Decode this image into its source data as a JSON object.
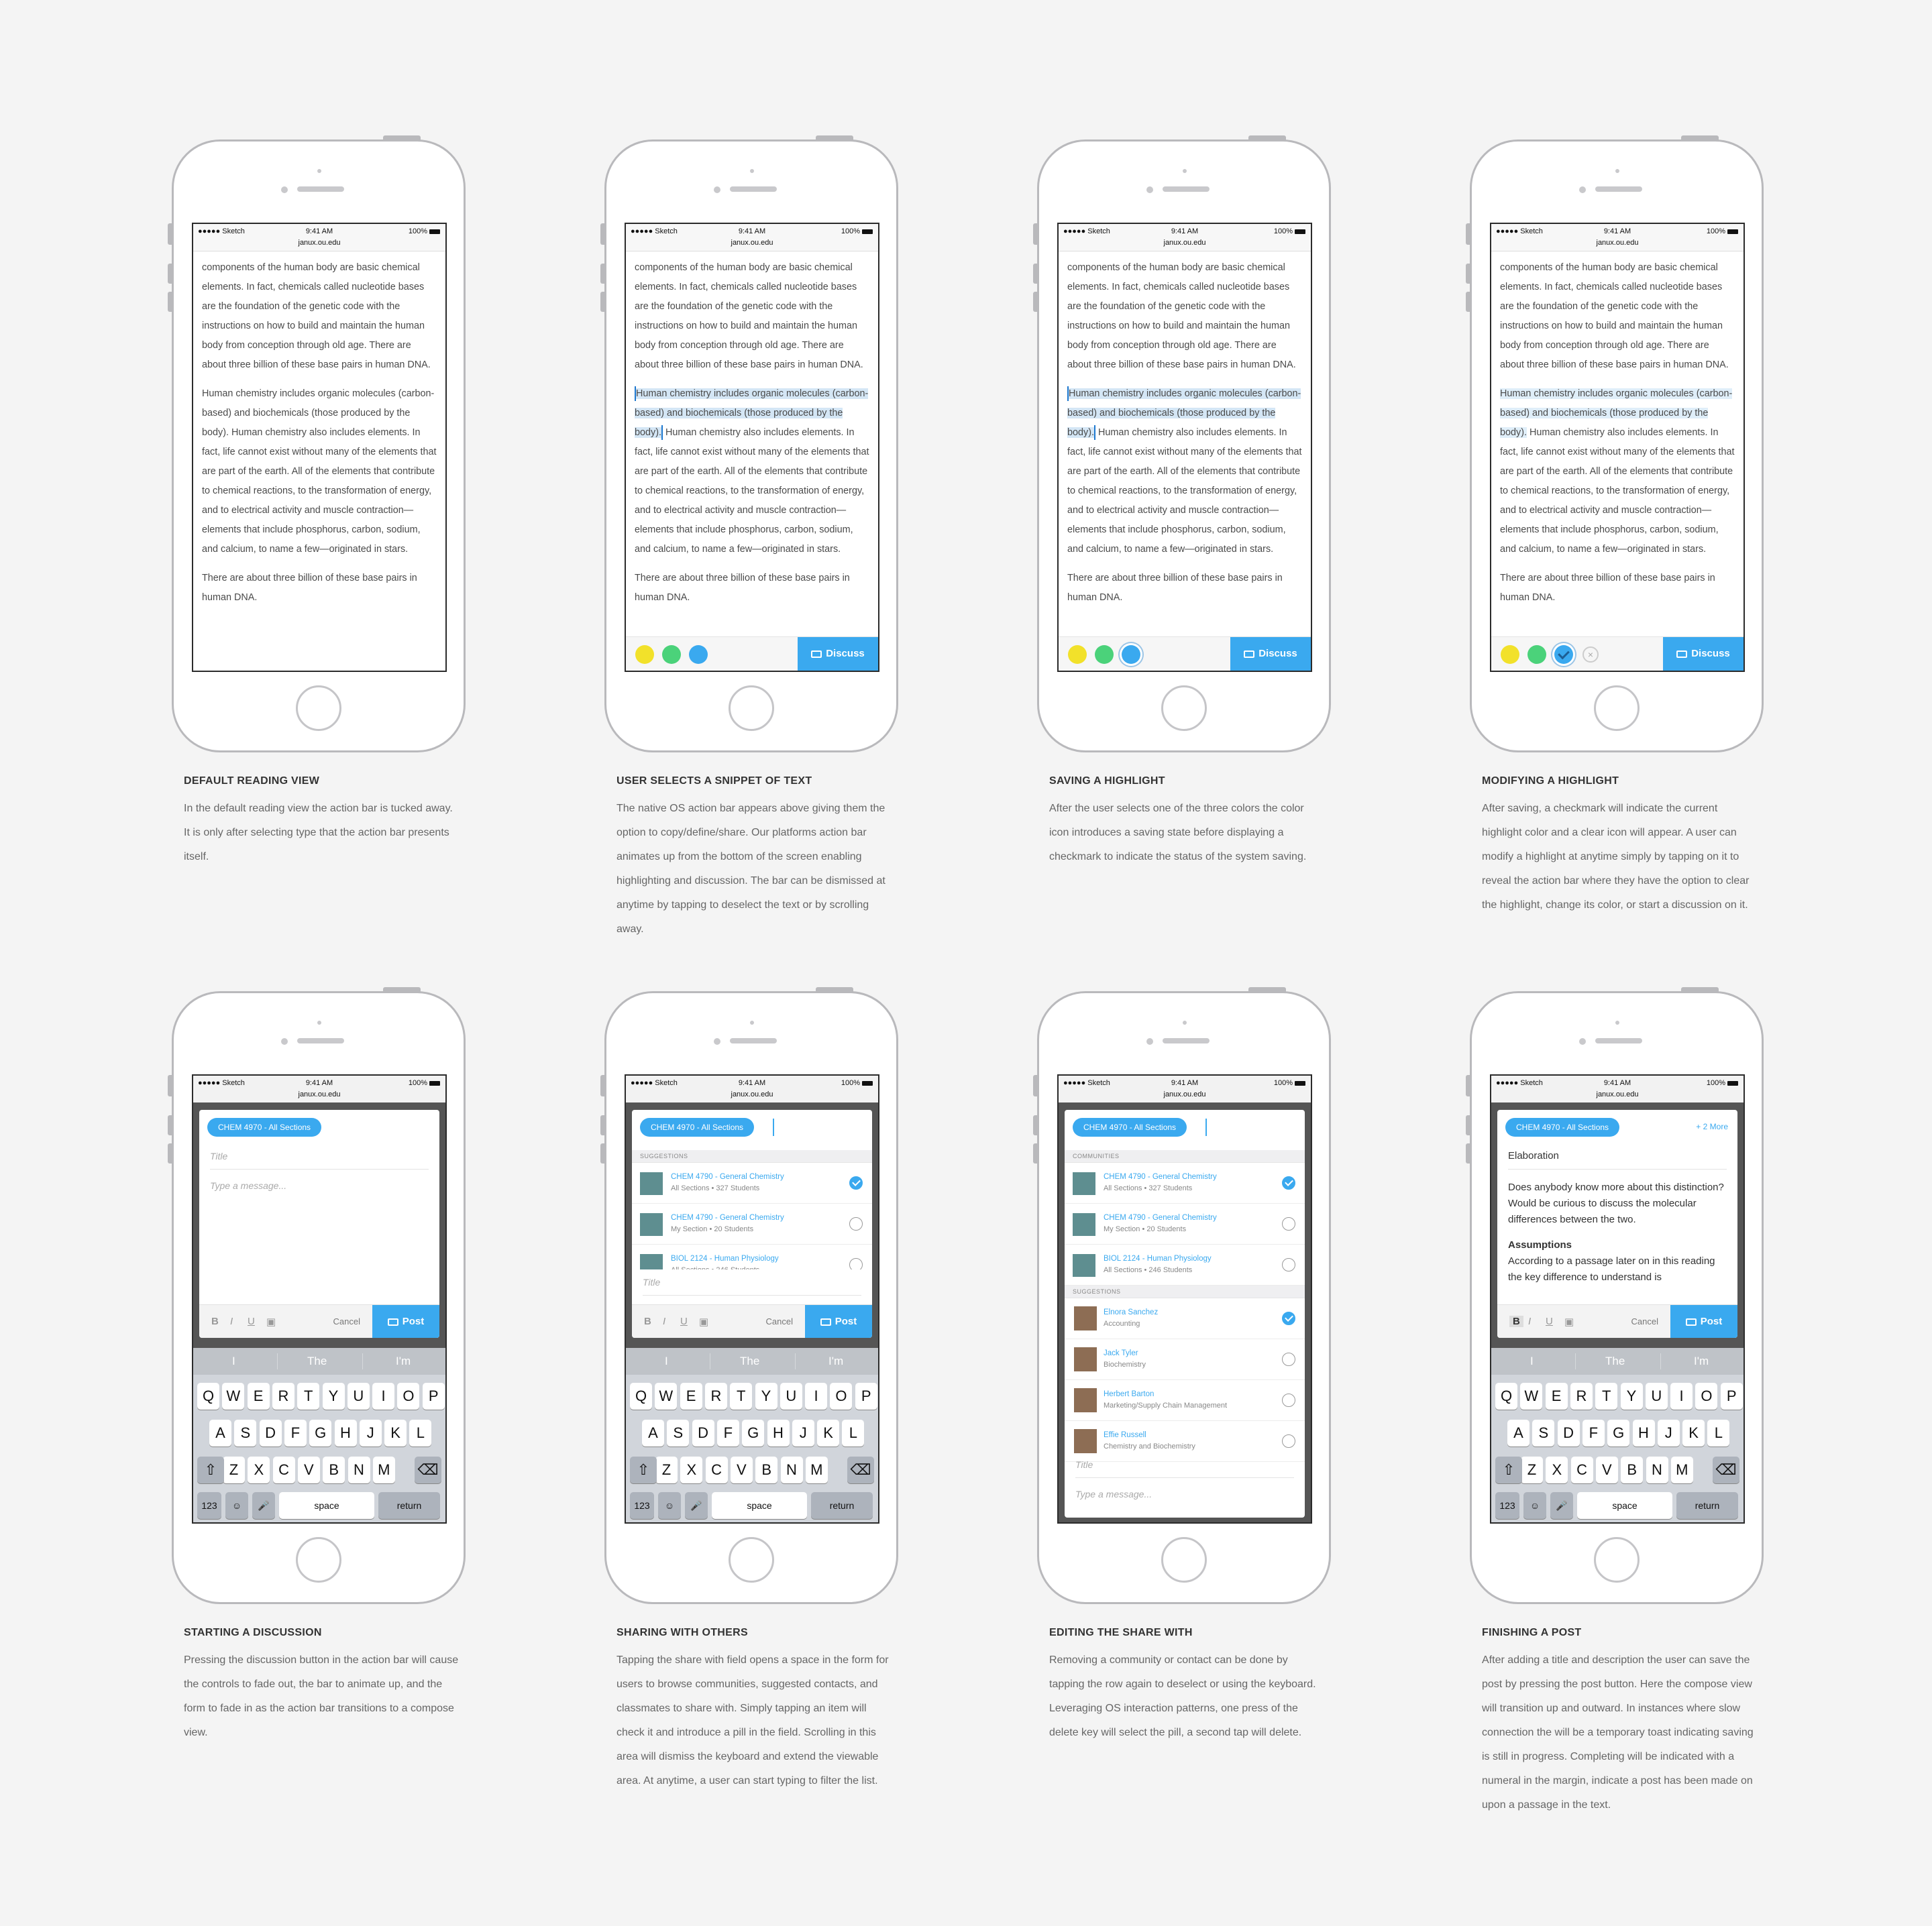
{
  "status": {
    "carrier": "●●●●● Sketch",
    "time": "9:41 AM",
    "battery": "100%",
    "url": "janux.ou.edu"
  },
  "article": {
    "p1": "components of the human body are basic chemical elements. In fact, chemicals called nucleotide bases are the foundation of the genetic code with the instructions on how to build and maintain the human body from conception through old age. There are about three billion of these base pairs in human DNA.",
    "p2_sel": "Human chemistry includes organic molecules (carbon-based) and biochemicals (those produced by the body).",
    "p2_rest": " Human chemistry also includes elements. In fact, life cannot exist without many of the elements that are part of the earth. All of the elements that contribute to chemical reactions, to the transformation of energy, and to electrical activity and muscle contraction—elements that include phosphorus, carbon, sodium, and calcium, to name a few—originated in stars.",
    "p3": "There are about three billion of these base pairs in human DNA."
  },
  "action_bar": {
    "discuss": "Discuss",
    "clear": "×"
  },
  "compose": {
    "pill": "CHEM 4970 - All Sections",
    "more": "+ 2 More",
    "title_ph": "Title",
    "message_ph": "Type a message...",
    "cancel": "Cancel",
    "post": "Post",
    "bold": "B",
    "italic": "I",
    "underline": "U",
    "title_value": "Elaboration",
    "body_value": "Does anybody know more about this distinction? Would be curious to discuss the molecular differences between the two.",
    "assumptions": "Assumptions",
    "assumptions_body": "According to a passage later on in this reading the key difference to understand is"
  },
  "lists": {
    "suggestions": "SUGGESTIONS",
    "communities": "COMMUNITIES",
    "c1": {
      "name": "CHEM 4790 - General Chemistry",
      "sub": "All Sections • 327 Students"
    },
    "c2": {
      "name": "CHEM 4790 - General Chemistry",
      "sub": "My Section • 20 Students"
    },
    "c3": {
      "name": "BIOL 2124 - Human Physiology",
      "sub": "All Sections • 246 Students"
    },
    "people": [
      {
        "name": "Elnora Sanchez",
        "sub": "Accounting"
      },
      {
        "name": "Jack Tyler",
        "sub": "Biochemistry"
      },
      {
        "name": "Herbert Barton",
        "sub": "Marketing/Supply Chain Management"
      },
      {
        "name": "Effie Russell",
        "sub": "Chemistry and Biochemistry"
      }
    ]
  },
  "keyboard": {
    "suggest": [
      "I",
      "The",
      "I'm"
    ],
    "row1": [
      "Q",
      "W",
      "E",
      "R",
      "T",
      "Y",
      "U",
      "I",
      "O",
      "P"
    ],
    "row2": [
      "A",
      "S",
      "D",
      "F",
      "G",
      "H",
      "J",
      "K",
      "L"
    ],
    "row3": [
      "Z",
      "X",
      "C",
      "V",
      "B",
      "N",
      "M"
    ],
    "num": "123",
    "space": "space",
    "return": "return"
  },
  "captions": [
    {
      "title": "DEFAULT READING VIEW",
      "body": "In the default reading view the action bar is tucked away. It is only after selecting type that the action bar presents itself."
    },
    {
      "title": "USER SELECTS A SNIPPET OF TEXT",
      "body": "The native OS action bar appears above giving them the option to copy/define/share. Our platforms action bar animates up from the bottom of the screen enabling highlighting and discussion. The bar can be dismissed at anytime by tapping to deselect the text or by scrolling away."
    },
    {
      "title": "SAVING A HIGHLIGHT",
      "body": "After the user selects one of the three colors the color icon introduces a saving state before displaying a checkmark to indicate the status of the system saving."
    },
    {
      "title": "MODIFYING A HIGHLIGHT",
      "body": "After saving, a checkmark will indicate the current highlight color and a clear icon will appear. A user can modify a highlight at anytime simply by tapping on it to reveal the action bar where they have the option to clear the highlight, change its color, or start a discussion on it."
    },
    {
      "title": "STARTING A DISCUSSION",
      "body": "Pressing the discussion button in the action bar will cause the controls to fade out, the bar to animate up, and the form to fade in as the action bar transitions to a compose view."
    },
    {
      "title": "SHARING WITH OTHERS",
      "body": "Tapping the share with field opens a space in the form for users to browse communities, suggested contacts, and classmates to share with. Simply tapping an item will check it and introduce a pill in the field. Scrolling in this area will dismiss the keyboard and extend the viewable area. At anytime, a user can start typing to filter the list."
    },
    {
      "title": "EDITING THE SHARE WITH",
      "body": "Removing a community or contact can be done by tapping the row again to deselect or using the keyboard. Leveraging OS interaction patterns, one press of the delete key will select the pill, a second tap will delete."
    },
    {
      "title": "FINISHING A POST",
      "body": "After adding a title and description the user can save the post by pressing the post button. Here the compose view will transition up and outward. In instances where slow connection the will be a temporary toast indicating saving is still in progress. Completing will be indicated with a numeral in the margin, indicate a post has been made on upon a passage in the text."
    }
  ]
}
